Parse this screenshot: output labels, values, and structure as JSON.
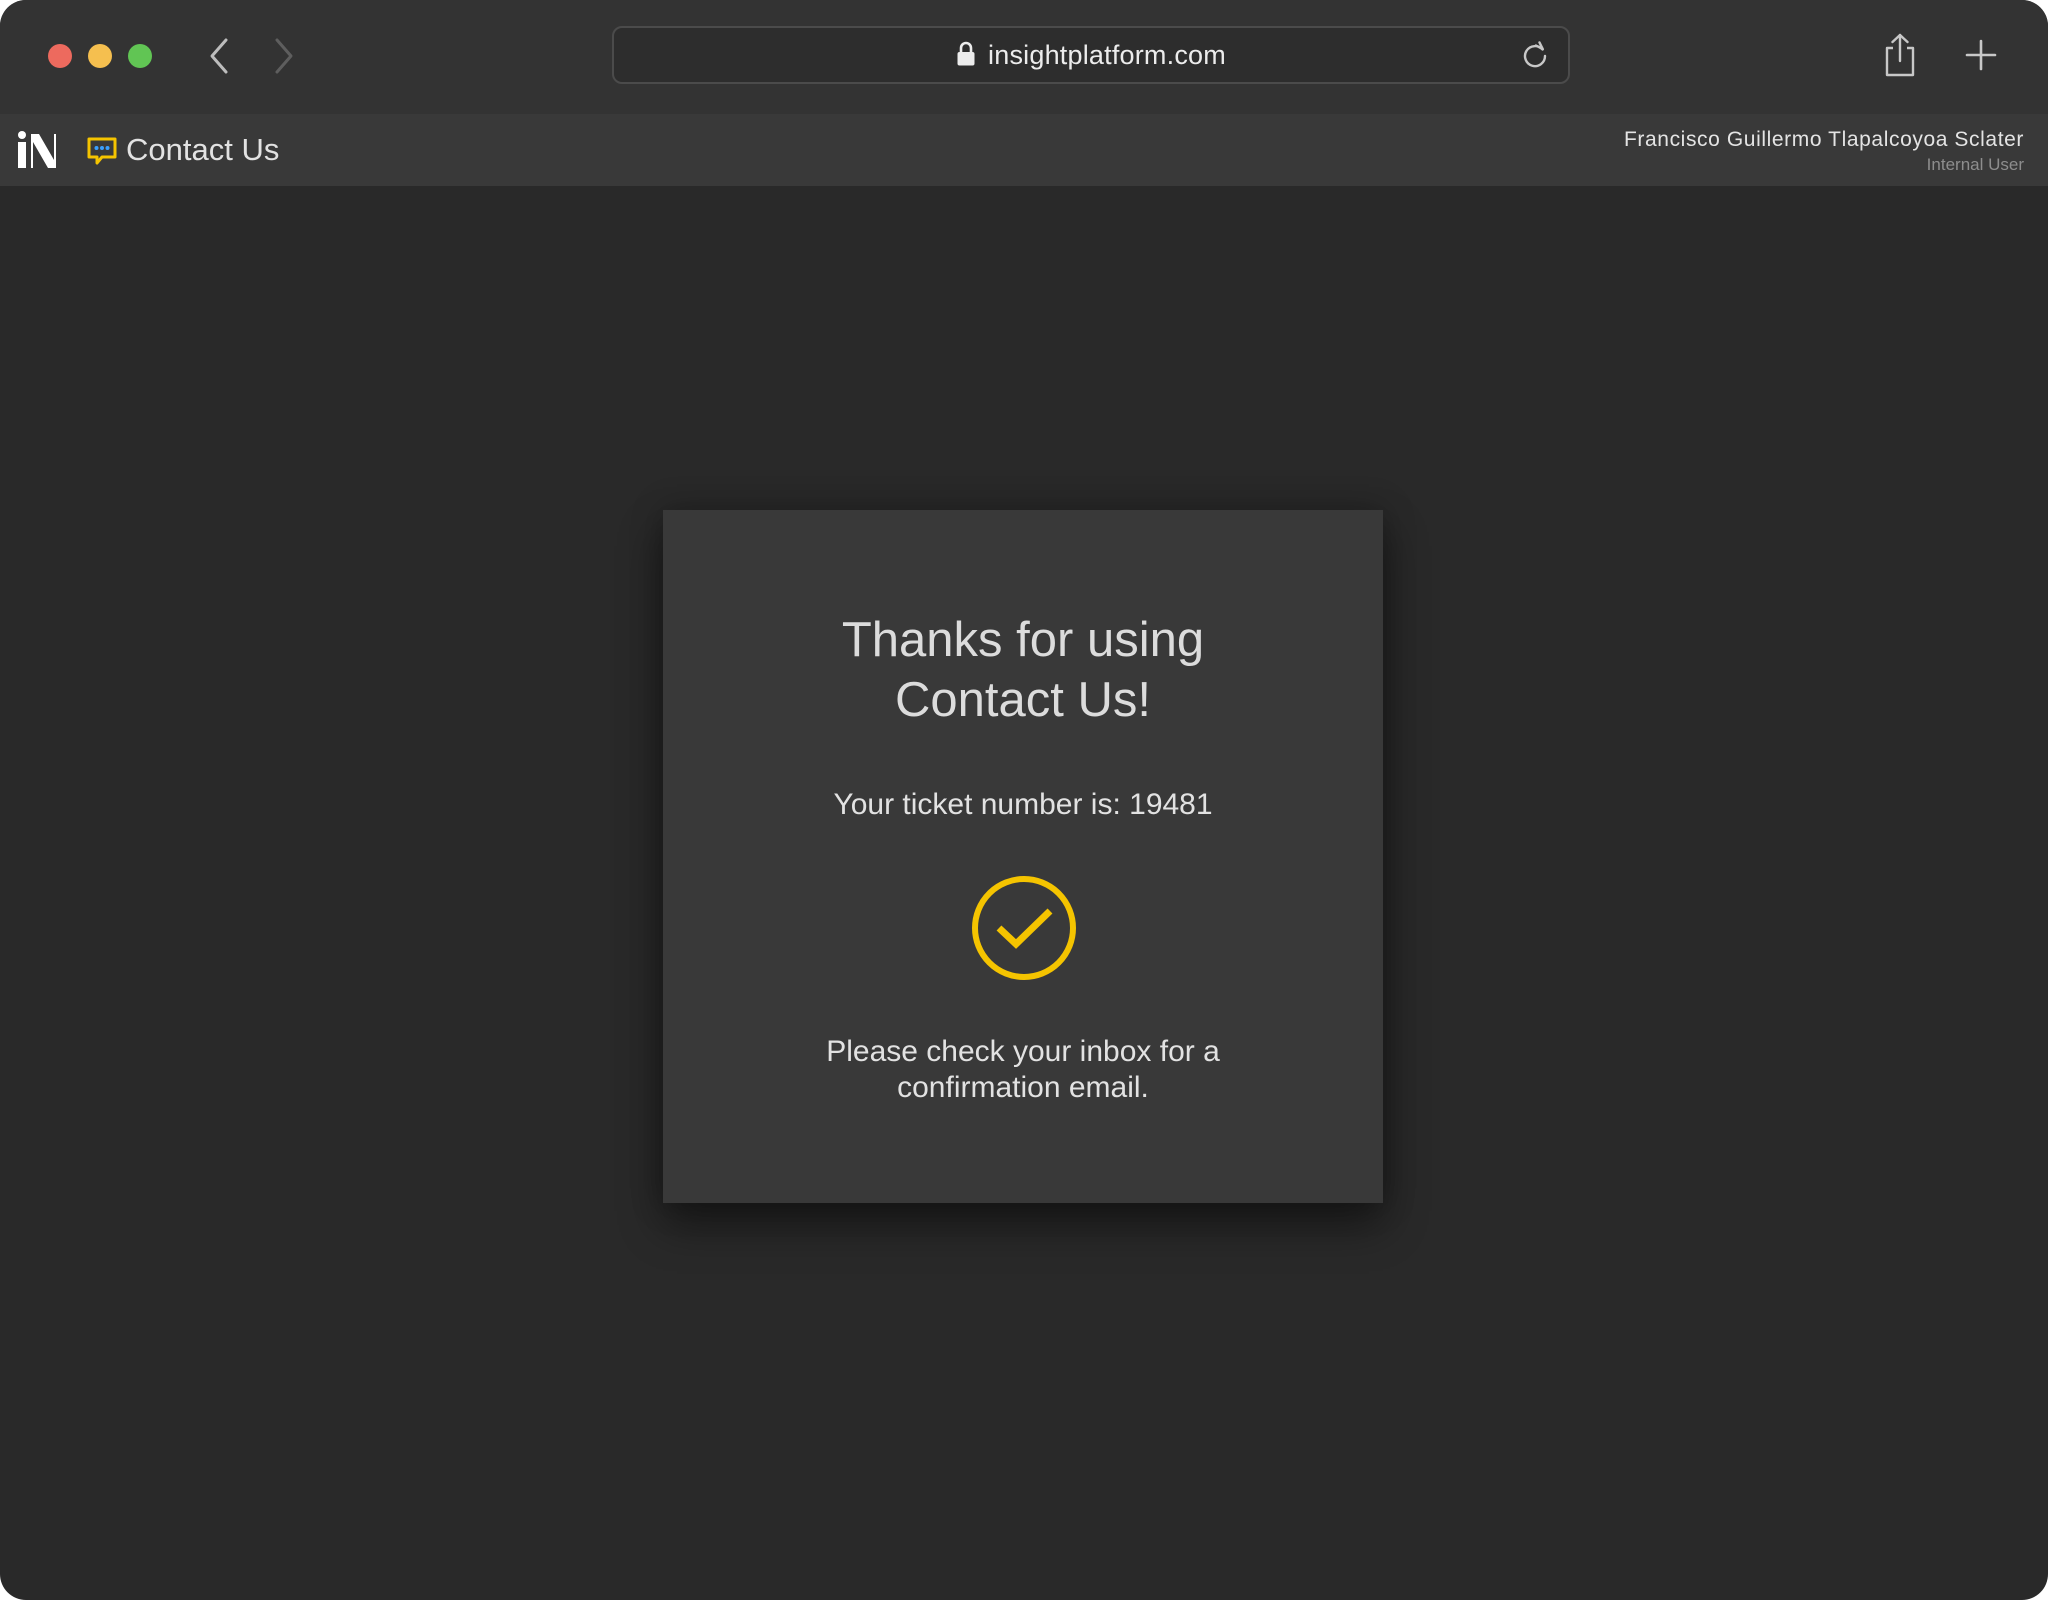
{
  "browser": {
    "url": "insightplatform.com",
    "icons": {
      "back": "chevron-left-icon",
      "forward": "chevron-right-icon",
      "lock": "lock-icon",
      "reload": "reload-icon",
      "share": "share-icon",
      "new_tab": "plus-icon"
    }
  },
  "header": {
    "title": "Contact Us",
    "user": {
      "name": "Francisco Guillermo Tlapalcoyoa Sclater",
      "role": "Internal User"
    }
  },
  "confirmation": {
    "title_line1": "Thanks for using",
    "title_line2": "Contact Us!",
    "ticket_text": "Your ticket number is: 19481",
    "message_line1": "Please check your inbox for a",
    "message_line2": "confirmation email."
  },
  "colors": {
    "accent": "#f5c400",
    "background": "#292929",
    "card": "#393939",
    "header": "#393939"
  }
}
